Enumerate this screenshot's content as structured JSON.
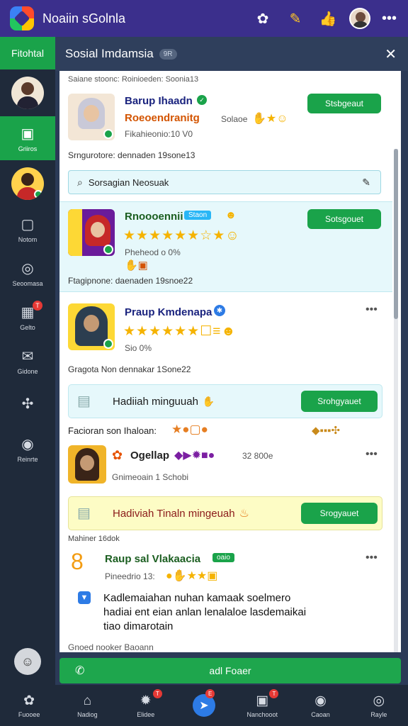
{
  "topbar": {
    "title": "Noaiin sGolnla"
  },
  "sidebar": {
    "header": "Fitohtal",
    "items": [
      {
        "label": "Griiros"
      },
      {
        "label": "Notom"
      },
      {
        "label": "Seoomasa"
      },
      {
        "label": "Gelto",
        "badge": "T"
      },
      {
        "label": "Gidone"
      },
      {
        "label": ""
      },
      {
        "label": "Reinrte"
      }
    ]
  },
  "panel": {
    "title": "Sosial Imdamsia",
    "pill": "9R",
    "meta_top": "Saiane stoonc: Roinioeden: Soonia13",
    "card1": {
      "name": "Barup Ihaadn",
      "line2": "Roeoendranitg",
      "line2_suffix": "Solaoe",
      "line3": "Fikahieonio:10 V0",
      "button": "Stsbgeaut"
    },
    "meta1": "Srngurotore: dennaden 19sone13",
    "search_placeholder": "Sorsagian Neosuak",
    "card2": {
      "name": "Rnoooennii",
      "chip": "Staon",
      "line3": "Pheheod o 0%",
      "button": "Sotsgouet"
    },
    "meta2": "Ftagipnone: daenaden 19snoe22",
    "card3": {
      "name": "Praup Kmdenapa",
      "line3": "Sio 0%"
    },
    "meta3": "Gragota Non dennakar 1Sone22",
    "promo1": {
      "text": "Hadiiah minguuah",
      "button": "Srohgyauet"
    },
    "meta4": "Facioran son Ihaloan:",
    "card4": {
      "name": "Ogellap",
      "count": "32 800e",
      "line2": "Gnimeoain 1 Schobi"
    },
    "promo2": {
      "text": "Hadiviah Tinaln mingeuah",
      "button": "Srogyauet"
    },
    "meta5": "Mahiner 16dok",
    "card5": {
      "name": "Raup sal Vlakaacia",
      "chip": "oaio",
      "line2": "Pineedrio 13:"
    },
    "message": [
      "Kadlemaiahan nuhan kamaak soelmero",
      "hadiai ent eian anlan lenalaloe lasdemaikai",
      "tiao dimarotain"
    ],
    "meta6": "Gnoed nooker Baoann"
  },
  "actionbar": {
    "label": "adl Foaer"
  },
  "bottomnav": {
    "items": [
      {
        "label": "Fuooee"
      },
      {
        "label": "Nadiog"
      },
      {
        "label": "Elidee",
        "badge": "T"
      },
      {
        "label": "",
        "badge": "E"
      },
      {
        "label": "Nanchooot",
        "badge": "T"
      },
      {
        "label": "Caoan"
      },
      {
        "label": "Rayle"
      }
    ]
  },
  "colors": {
    "accent": "#1aa34a",
    "topbar": "#3b2f8c",
    "sidebar": "#1f2a3a",
    "stars": "#f5b301"
  }
}
